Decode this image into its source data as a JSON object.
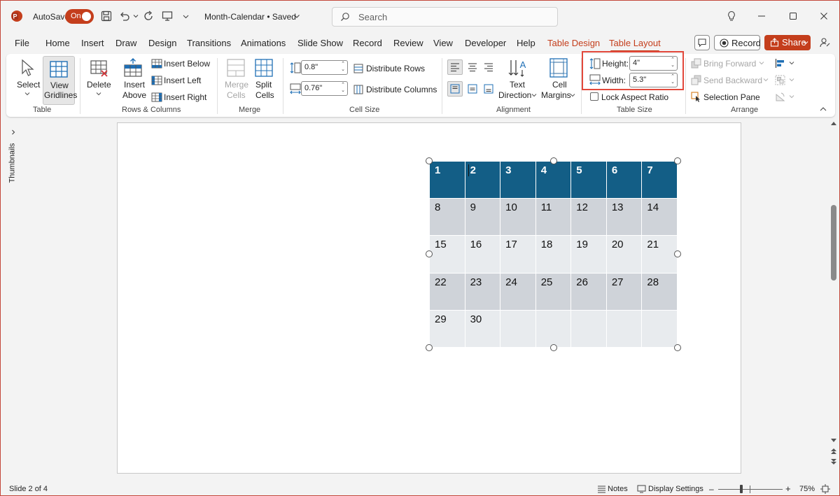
{
  "titlebar": {
    "autosave_label": "AutoSave",
    "autosave_state": "On",
    "doc_title": "Month-Calendar • Saved",
    "search_placeholder": "Search",
    "app_icon": "powerpoint-logo",
    "accent": "#c43e1c"
  },
  "menu": {
    "tabs": [
      "File",
      "Home",
      "Insert",
      "Draw",
      "Design",
      "Transitions",
      "Animations",
      "Slide Show",
      "Record",
      "Review",
      "View",
      "Developer",
      "Help",
      "Table Design",
      "Table Layout"
    ],
    "active": "Table Layout",
    "record_label": "Record",
    "share_label": "Share"
  },
  "ribbon": {
    "table": {
      "select_label": "Select",
      "view_label": "View",
      "gridlines_label": "Gridlines",
      "group_label": "Table"
    },
    "rows_columns": {
      "delete_label": "Delete",
      "insert_label": "Insert",
      "above_label": "Above",
      "insert_below": "Insert Below",
      "insert_left": "Insert Left",
      "insert_right": "Insert Right",
      "group_label": "Rows & Columns"
    },
    "merge": {
      "merge_label": "Merge",
      "cells_label": "Cells",
      "split_label": "Split",
      "split_cells_label": "Cells",
      "group_label": "Merge"
    },
    "cell_size": {
      "height_value": "0.8\"",
      "width_value": "0.76\"",
      "distribute_rows": "Distribute Rows",
      "distribute_columns": "Distribute Columns",
      "group_label": "Cell Size"
    },
    "alignment": {
      "text_label": "Text",
      "direction_label": "Direction",
      "cell_label": "Cell",
      "margins_label": "Margins",
      "group_label": "Alignment"
    },
    "table_size": {
      "height_label": "Height:",
      "height_value": "4\"",
      "width_label": "Width:",
      "width_value": "5.3\"",
      "lock_label": "Lock Aspect Ratio",
      "group_label": "Table Size",
      "highlight_color": "#e2483b"
    },
    "arrange": {
      "bring_forward": "Bring Forward",
      "send_backward": "Send Backward",
      "selection_pane": "Selection Pane",
      "group_label": "Arrange"
    }
  },
  "sidepanel": {
    "thumbnails_label": "Thumbnails"
  },
  "calendar": {
    "header_color": "#135e86",
    "rows": [
      [
        "1",
        "2",
        "3",
        "4",
        "5",
        "6",
        "7"
      ],
      [
        "8",
        "9",
        "10",
        "11",
        "12",
        "13",
        "14"
      ],
      [
        "15",
        "16",
        "17",
        "18",
        "19",
        "20",
        "21"
      ],
      [
        "22",
        "23",
        "24",
        "25",
        "26",
        "27",
        "28"
      ],
      [
        "29",
        "30",
        "",
        "",
        "",
        "",
        ""
      ]
    ]
  },
  "status": {
    "slide_info": "Slide 2 of 4",
    "notes_label": "Notes",
    "display_settings_label": "Display Settings",
    "zoom_minus": "–",
    "zoom_plus": "+",
    "zoom_level": "75%"
  }
}
